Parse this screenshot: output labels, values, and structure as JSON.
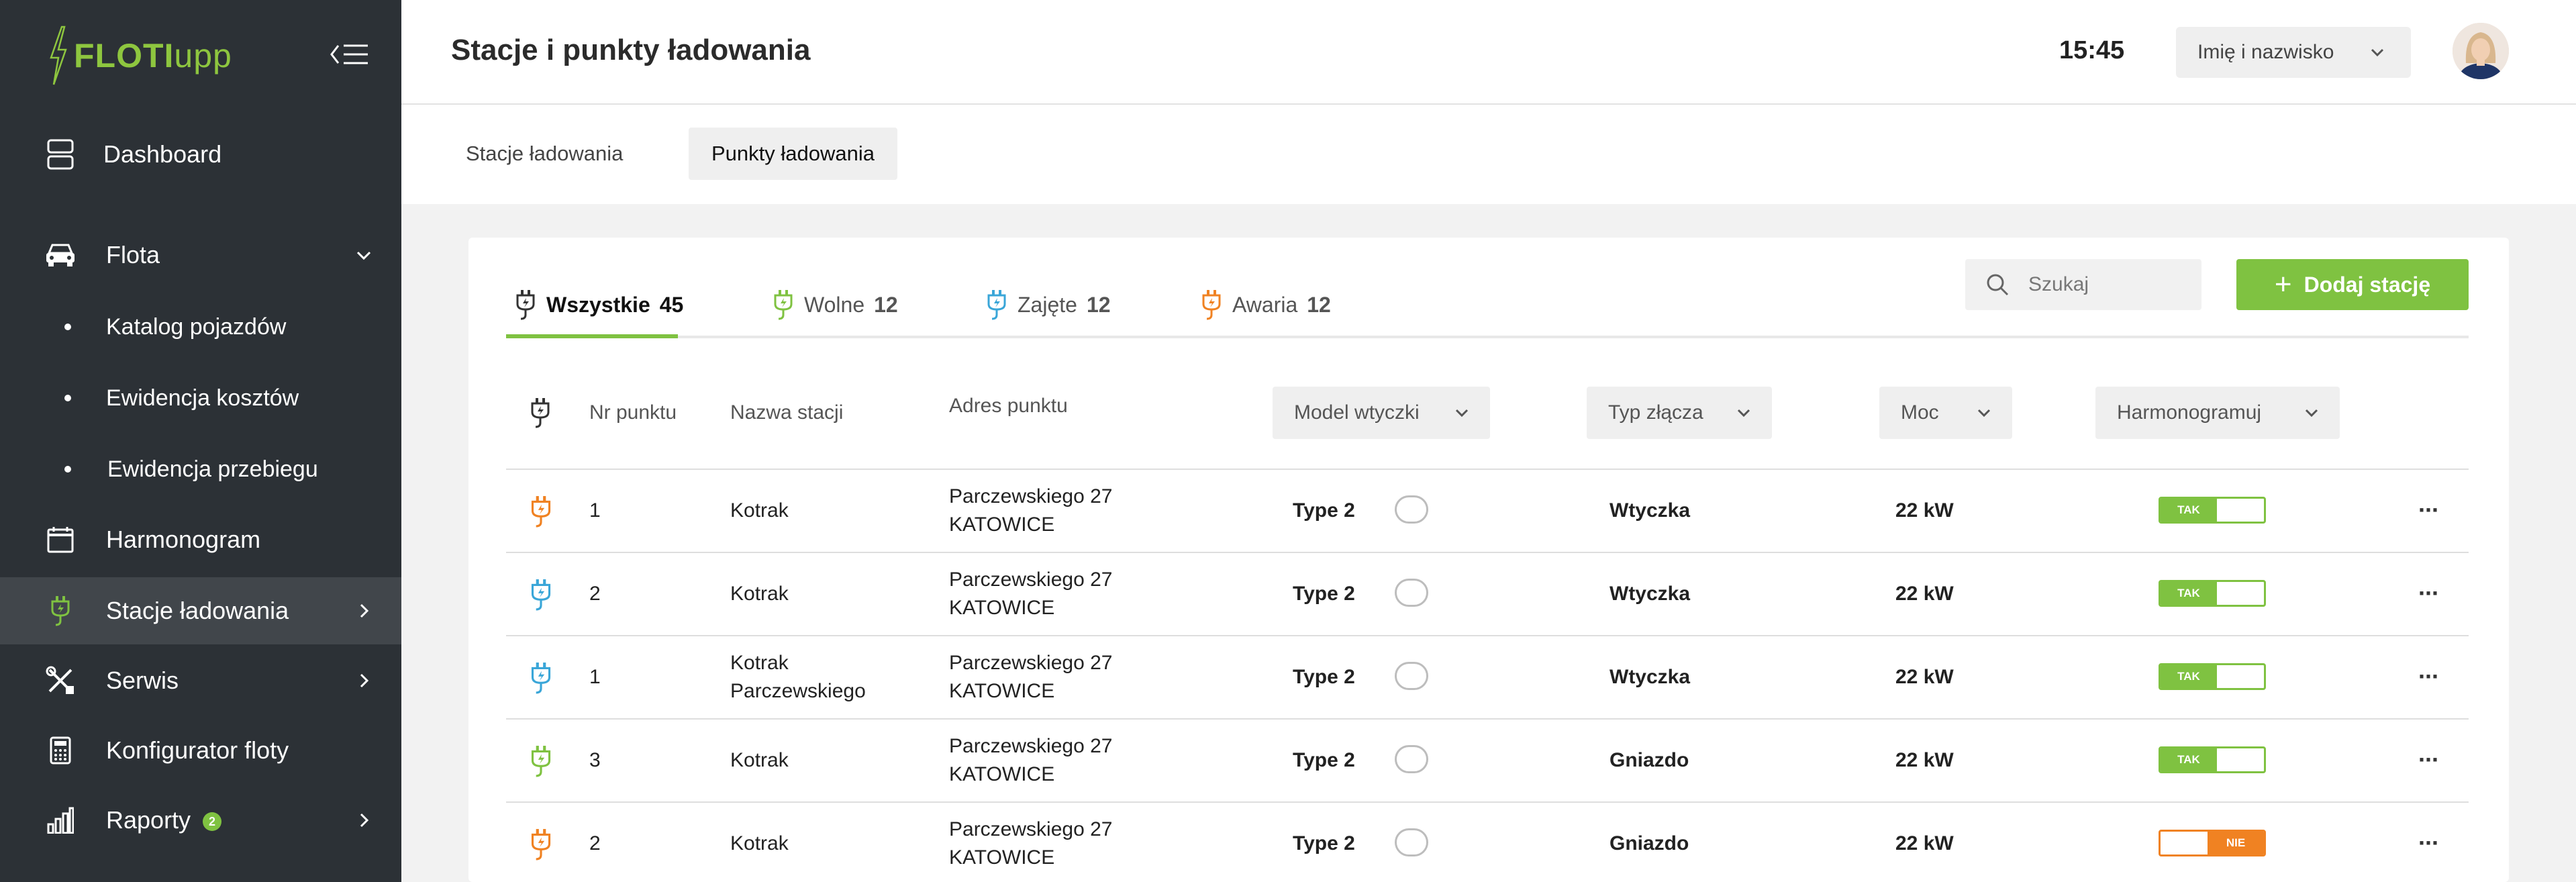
{
  "app": {
    "logo_main": "FLOTI",
    "logo_suffix": "upp"
  },
  "sidebar": {
    "items": [
      {
        "label": "Dashboard"
      },
      {
        "label": "Flota"
      },
      {
        "label": "Harmonogram"
      },
      {
        "label": "Stacje ładowania"
      },
      {
        "label": "Serwis"
      },
      {
        "label": "Konfigurator floty"
      },
      {
        "label": "Raporty",
        "badge": "2"
      }
    ],
    "sub_items": [
      {
        "label": "Katalog pojazdów"
      },
      {
        "label": "Ewidencja kosztów"
      },
      {
        "label": "Ewidencja przebiegu"
      }
    ]
  },
  "header": {
    "title": "Stacje i punkty ładowania",
    "time": "15:45",
    "user_select": "Imię i nazwisko"
  },
  "subtabs": [
    {
      "label": "Stacje ładowania"
    },
    {
      "label": "Punkty ładowania"
    }
  ],
  "filters": [
    {
      "label": "Wszystkie",
      "count": "45"
    },
    {
      "label": "Wolne",
      "count": "12"
    },
    {
      "label": "Zajęte",
      "count": "12"
    },
    {
      "label": "Awaria",
      "count": "12"
    }
  ],
  "search": {
    "placeholder": "Szukaj"
  },
  "add_button": {
    "label": "Dodaj stację"
  },
  "table": {
    "headers": {
      "nr": "Nr punktu",
      "name": "Nazwa stacji",
      "address": "Adres punktu",
      "model": "Model wtyczki",
      "connector": "Typ złącza",
      "power": "Moc",
      "schedule": "Harmonogramuj"
    },
    "rows": [
      {
        "status": "awaria",
        "nr": "1",
        "name1": "Kotrak",
        "name2": "",
        "addr1": "Parczewskiego 27",
        "addr2": "KATOWICE",
        "model": "Type 2",
        "connector": "Wtyczka",
        "power": "22 kW",
        "schedule": "TAK",
        "on": true
      },
      {
        "status": "zajete",
        "nr": "2",
        "name1": "Kotrak",
        "name2": "",
        "addr1": "Parczewskiego 27",
        "addr2": "KATOWICE",
        "model": "Type 2",
        "connector": "Wtyczka",
        "power": "22 kW",
        "schedule": "TAK",
        "on": true
      },
      {
        "status": "zajete",
        "nr": "1",
        "name1": "Kotrak",
        "name2": "Parczewskiego",
        "addr1": "Parczewskiego 27",
        "addr2": "KATOWICE",
        "model": "Type 2",
        "connector": "Wtyczka",
        "power": "22 kW",
        "schedule": "TAK",
        "on": true
      },
      {
        "status": "wolne",
        "nr": "3",
        "name1": "Kotrak",
        "name2": "",
        "addr1": "Parczewskiego 27",
        "addr2": "KATOWICE",
        "model": "Type 2",
        "connector": "Gniazdo",
        "power": "22 kW",
        "schedule": "TAK",
        "on": true
      },
      {
        "status": "awaria",
        "nr": "2",
        "name1": "Kotrak",
        "name2": "",
        "addr1": "Parczewskiego 27",
        "addr2": "KATOWICE",
        "model": "Type 2",
        "connector": "Gniazdo",
        "power": "22 kW",
        "schedule": "NIE",
        "on": false
      }
    ]
  },
  "colors": {
    "accent": "#7fc241",
    "sidebar_bg": "#2c3136",
    "status_wolne": "#7fc241",
    "status_zajete": "#3aa6d8",
    "status_awaria": "#f08222",
    "status_all": "#333333"
  },
  "icons": {
    "dashboard": "dashboard-icon",
    "fleet": "car-icon",
    "schedule": "calendar-icon",
    "charging": "charging-plug-icon",
    "service": "tools-icon",
    "configurator": "calculator-icon",
    "reports": "bar-chart-icon"
  }
}
